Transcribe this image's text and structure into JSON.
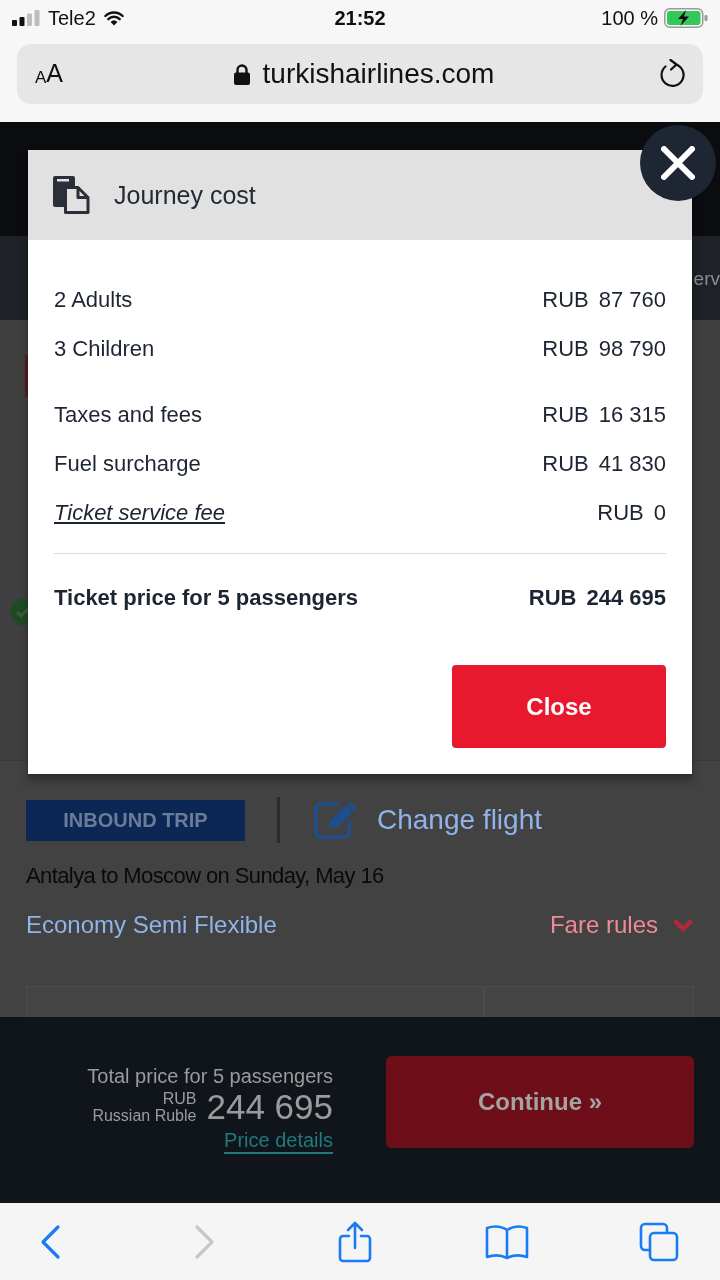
{
  "status_bar": {
    "carrier": "Tele2",
    "time": "21:52",
    "battery": "100 %"
  },
  "address_bar": {
    "text_size_button": "AA",
    "url": "turkishairlines.com"
  },
  "page": {
    "nav_partial_text": "erv",
    "trip_badge": "INBOUND TRIP",
    "change_flight_link": "Change flight",
    "route": "Antalya to Moscow on Sunday, May 16",
    "fare_class": "Economy Semi Flexible",
    "fare_rules_link": "Fare rules"
  },
  "modal": {
    "title": "Journey cost",
    "sections": [
      {
        "rows": [
          {
            "kind": "plain",
            "label": "2 Adults",
            "currency": "RUB",
            "amount": "87 760"
          },
          {
            "kind": "plain",
            "label": "3 Children",
            "currency": "RUB",
            "amount": "98 790"
          }
        ]
      },
      {
        "rows": [
          {
            "kind": "plain",
            "label": "Taxes and fees",
            "currency": "RUB",
            "amount": "16 315"
          },
          {
            "kind": "plain",
            "label": "Fuel surcharge",
            "currency": "RUB",
            "amount": "41 830"
          },
          {
            "kind": "link",
            "label": "Ticket service fee",
            "currency": "RUB",
            "amount": "0"
          }
        ]
      }
    ],
    "total": {
      "label": "Ticket price for 5 passengers",
      "currency": "RUB",
      "amount": "244 695"
    },
    "close_button": "Close"
  },
  "bottom_bar": {
    "total_label": "Total price for 5 passengers",
    "currency_code": "RUB",
    "currency_name": "Russian Ruble",
    "amount": "244 695",
    "details_link": "Price details",
    "continue_button": "Continue »"
  },
  "browser_toolbar": {
    "back_enabled": true,
    "forward_enabled": false
  }
}
